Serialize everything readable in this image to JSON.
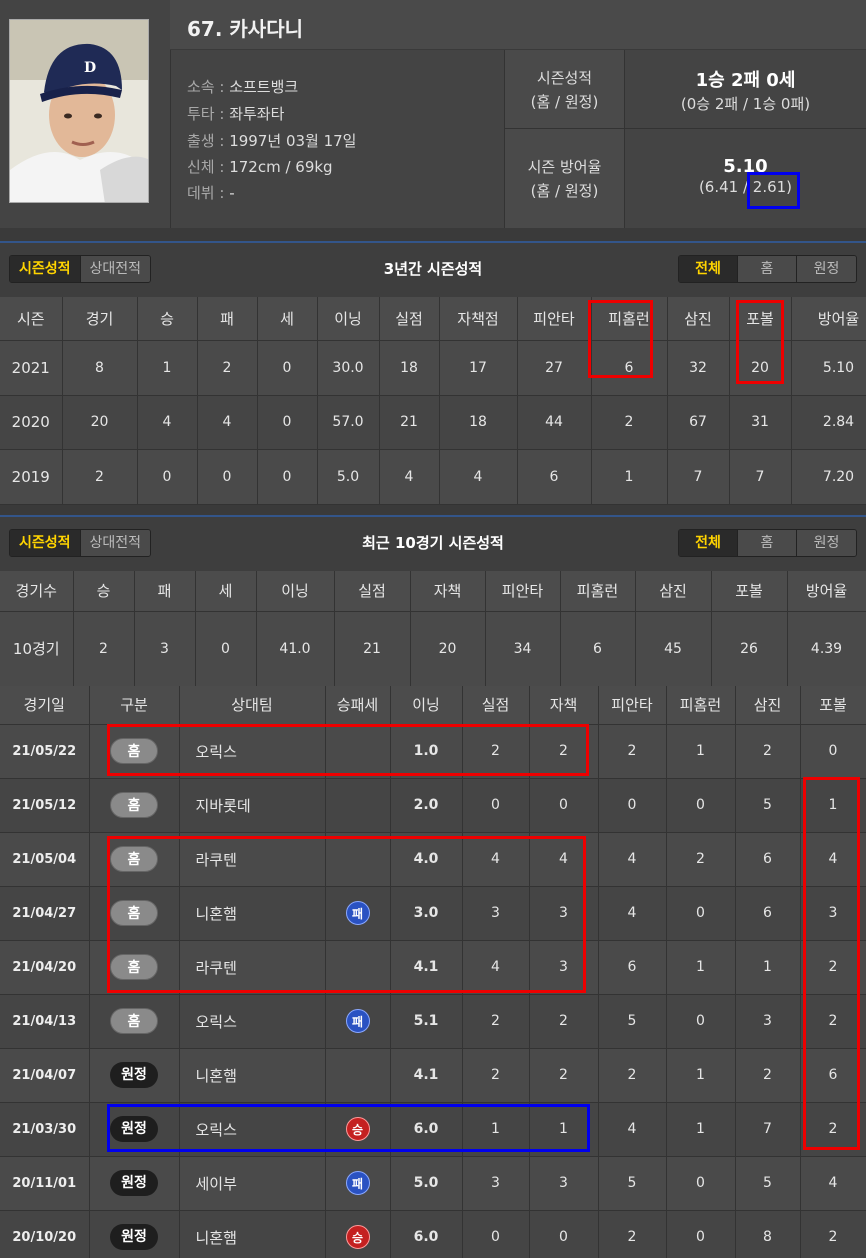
{
  "player": {
    "name": "67. 카사다니",
    "info": [
      {
        "k": "소속 : ",
        "v": "소프트뱅크"
      },
      {
        "k": "투타 : ",
        "v": "좌투좌타"
      },
      {
        "k": "출생 : ",
        "v": "1997년 03월 17일"
      },
      {
        "k": "신체 : ",
        "v": "172cm / 69kg"
      },
      {
        "k": "데뷔 : ",
        "v": "-"
      }
    ],
    "summary": {
      "record_label1": "시즌성적",
      "record_label2": "(홈 / 원정)",
      "record_main": "1승 2패 0세",
      "record_sub": "(0승 2패 / 1승 0패)",
      "era_label1": "시즌 방어율",
      "era_label2": "(홈 / 원정)",
      "era_main": "5.10",
      "era_sub_home": "(6.41 / ",
      "era_sub_away": "2.61)"
    }
  },
  "colors": {
    "highlight_red": "#ee0000",
    "highlight_blue": "#0000ee",
    "tab_active": "#ffd400"
  },
  "section1": {
    "tabs": [
      "시즌성적",
      "상대전적"
    ],
    "title": "3년간 시즌성적",
    "filters": [
      "전체",
      "홈",
      "원정"
    ],
    "headers": [
      "시즌",
      "경기",
      "승",
      "패",
      "세",
      "이닝",
      "실점",
      "자책점",
      "피안타",
      "피홈런",
      "삼진",
      "포볼",
      "방어율"
    ],
    "rows": [
      [
        "2021",
        "8",
        "1",
        "2",
        "0",
        "30.0",
        "18",
        "17",
        "27",
        "6",
        "32",
        "20",
        "5.10"
      ],
      [
        "2020",
        "20",
        "4",
        "4",
        "0",
        "57.0",
        "21",
        "18",
        "44",
        "2",
        "67",
        "31",
        "2.84"
      ],
      [
        "2019",
        "2",
        "0",
        "0",
        "0",
        "5.0",
        "4",
        "4",
        "6",
        "1",
        "7",
        "7",
        "7.20"
      ]
    ]
  },
  "section2": {
    "tabs": [
      "시즌성적",
      "상대전적"
    ],
    "title": "최근 10경기 시즌성적",
    "filters": [
      "전체",
      "홈",
      "원정"
    ],
    "headers": [
      "경기수",
      "승",
      "패",
      "세",
      "이닝",
      "실점",
      "자책",
      "피안타",
      "피홈런",
      "삼진",
      "포볼",
      "방어율"
    ],
    "row": [
      "10경기",
      "2",
      "3",
      "0",
      "41.0",
      "21",
      "20",
      "34",
      "6",
      "45",
      "26",
      "4.39"
    ]
  },
  "games": {
    "headers": [
      "경기일",
      "구분",
      "상대팀",
      "승패세",
      "이닝",
      "실점",
      "자책",
      "피안타",
      "피홈런",
      "삼진",
      "포볼"
    ],
    "rows": [
      [
        "21/05/22",
        "홈",
        "오릭스",
        "",
        "1.0",
        "2",
        "2",
        "2",
        "1",
        "2",
        "0"
      ],
      [
        "21/05/12",
        "홈",
        "지바롯데",
        "",
        "2.0",
        "0",
        "0",
        "0",
        "0",
        "5",
        "1"
      ],
      [
        "21/05/04",
        "홈",
        "라쿠텐",
        "",
        "4.0",
        "4",
        "4",
        "4",
        "2",
        "6",
        "4"
      ],
      [
        "21/04/27",
        "홈",
        "니혼햄",
        "패",
        "3.0",
        "3",
        "3",
        "4",
        "0",
        "6",
        "3"
      ],
      [
        "21/04/20",
        "홈",
        "라쿠텐",
        "",
        "4.1",
        "4",
        "3",
        "6",
        "1",
        "1",
        "2"
      ],
      [
        "21/04/13",
        "홈",
        "오릭스",
        "패",
        "5.1",
        "2",
        "2",
        "5",
        "0",
        "3",
        "2"
      ],
      [
        "21/04/07",
        "원정",
        "니혼햄",
        "",
        "4.1",
        "2",
        "2",
        "2",
        "1",
        "2",
        "6"
      ],
      [
        "21/03/30",
        "원정",
        "오릭스",
        "승",
        "6.0",
        "1",
        "1",
        "4",
        "1",
        "7",
        "2"
      ],
      [
        "20/11/01",
        "원정",
        "세이부",
        "패",
        "5.0",
        "3",
        "3",
        "5",
        "0",
        "5",
        "4"
      ],
      [
        "20/10/20",
        "원정",
        "니혼햄",
        "승",
        "6.0",
        "0",
        "0",
        "2",
        "0",
        "8",
        "2"
      ]
    ]
  }
}
